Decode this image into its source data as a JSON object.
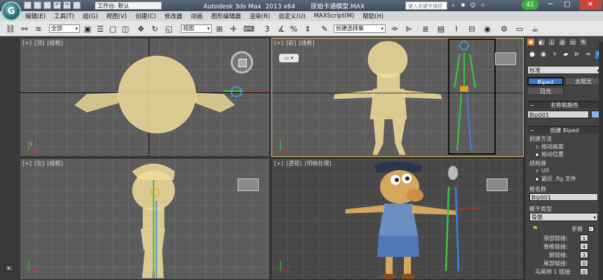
{
  "titlebar": {
    "logo_text": "G",
    "workspace": "工作台: 默认",
    "app_name": "Autodesk 3ds Max",
    "version": "2013 x64",
    "file_name": "原始卡通模型.MAX",
    "search_placeholder": "键入关键字或短语",
    "badge_count": "41",
    "min": "─",
    "max": "□",
    "close": "✕"
  },
  "menu": [
    "编辑(E)",
    "工具(T)",
    "组(G)",
    "视图(V)",
    "创建(C)",
    "修改器",
    "动画",
    "图形编辑器",
    "渲染(R)",
    "自定义(U)",
    "MAXScript(M)",
    "帮助(H)"
  ],
  "toolbar": {
    "filter_select": "全部",
    "ref_select": "视图",
    "named_selection": "创建选择集"
  },
  "viewports": {
    "top": {
      "label": [
        "[+]",
        "[顶]",
        "[线框]"
      ]
    },
    "front": {
      "label": [
        "[+]",
        "[前]",
        "[线框]"
      ]
    },
    "left": {
      "label": [
        "[+]",
        "[左]",
        "[线框]"
      ]
    },
    "persp": {
      "label": [
        "[+]",
        "[透视]",
        "[明暗处理]"
      ]
    }
  },
  "panel": {
    "category_select": "标准",
    "btn_biped": "Biped",
    "btn_sunlight": "太阳光",
    "btn_daylight": "日光",
    "section_name_color": "名称和颜色",
    "name_value": "Bip001",
    "section_create_biped": "创建 Biped",
    "creation_method": "创建方法",
    "opt_drag_height": "拖动高度",
    "opt_drag_position": "拖动位置",
    "structure_source": "结构源",
    "opt_ui": "U/I",
    "opt_recent_fig": "最近 .fig 文件",
    "root_name_label": "根名称",
    "root_name_value": "Bip001",
    "body_type_label": "躯干类型",
    "body_type_value": "骨骼",
    "arms_label": "手臂",
    "neck_links": "颈部链接:",
    "neck_links_val": "1",
    "spine_links": "脊椎链接:",
    "spine_links_val": "4",
    "leg_links": "腿链接:",
    "leg_links_val": "3",
    "tail_links": "尾部链接:",
    "tail_links_val": "0",
    "ponytail1": "马尾辫 1 链接:",
    "ponytail1_val": "0"
  },
  "colors": {
    "wireframe": "#f0dd9a",
    "accent": "#3a78c8",
    "active_border": "#d8b34a"
  }
}
